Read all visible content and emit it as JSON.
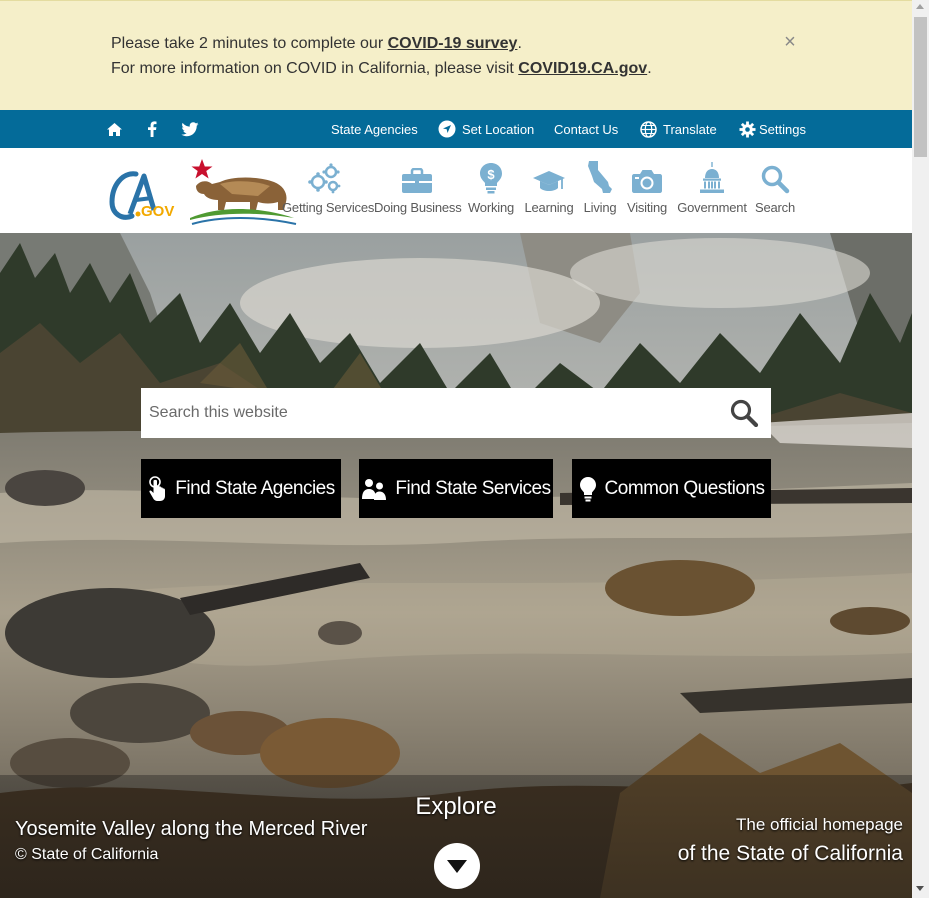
{
  "alert": {
    "line1_prefix": "Please take 2 minutes to complete our ",
    "line1_link": "COVID-19 survey",
    "line1_suffix": ".",
    "line2_prefix": "For more information on COVID in California, please visit ",
    "line2_link": "COVID19.CA.gov",
    "line2_suffix": ".",
    "close": "×"
  },
  "utility": {
    "home_icon": "home-icon",
    "facebook_icon": "facebook-icon",
    "twitter_icon": "twitter-icon",
    "state_agencies": "State Agencies",
    "set_location": "Set Location",
    "contact_us": "Contact Us",
    "translate": "Translate",
    "settings": "Settings"
  },
  "header": {
    "logo_text": "CA.GOV",
    "nav": [
      {
        "label": "Getting Services",
        "icon": "gears-icon"
      },
      {
        "label": "Doing Business",
        "icon": "briefcase-icon"
      },
      {
        "label": "Working",
        "icon": "lightbulb-dollar-icon"
      },
      {
        "label": "Learning",
        "icon": "graduation-cap-icon"
      },
      {
        "label": "Living",
        "icon": "california-icon"
      },
      {
        "label": "Visiting",
        "icon": "camera-icon"
      },
      {
        "label": "Government",
        "icon": "capitol-icon"
      },
      {
        "label": "Search",
        "icon": "search-icon"
      }
    ]
  },
  "hero": {
    "search_placeholder": "Search this website",
    "buttons": [
      {
        "label": "Find State Agencies",
        "icon": "hand-pointer-icon"
      },
      {
        "label": "Find State Services",
        "icon": "people-icon"
      },
      {
        "label": "Common Questions",
        "icon": "lightbulb-icon"
      }
    ],
    "caption_title": "Yosemite Valley along the Merced River",
    "caption_credit": "© State of California",
    "explore": "Explore",
    "official_line1": "The official homepage",
    "official_line2": "of the State of California"
  },
  "colors": {
    "alert_bg": "#f5efc9",
    "utility_bg": "#046b99",
    "nav_icon": "#7bb0d1",
    "button_bg": "#000000"
  }
}
